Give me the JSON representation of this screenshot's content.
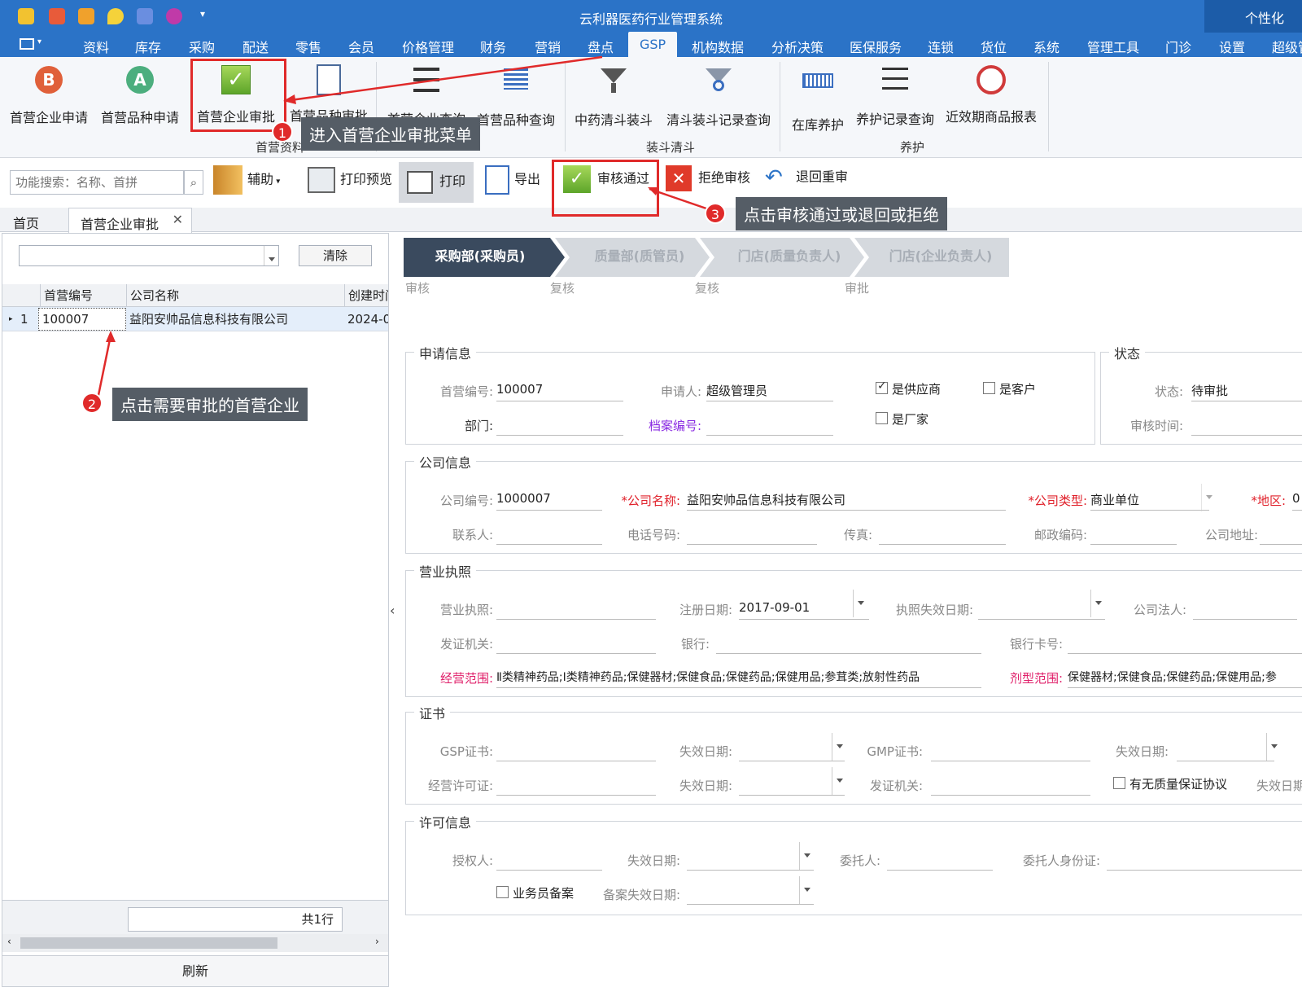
{
  "app": {
    "title": "云利器医药行业管理系统",
    "personal": "个性化"
  },
  "menu": {
    "items": [
      "资料",
      "库存",
      "采购",
      "配送",
      "零售",
      "会员",
      "价格管理",
      "财务",
      "营销",
      "盘点",
      "GSP",
      "机构数据",
      "分析决策",
      "医保服务",
      "连锁",
      "货位",
      "系统",
      "管理工具",
      "门诊",
      "设置",
      "超级管"
    ],
    "active": "GSP"
  },
  "ribbon": {
    "buttons": {
      "first_enterprise_apply": "首营企业申请",
      "first_variety_apply": "首营品种申请",
      "first_enterprise_approve": "首营企业审批",
      "first_variety_approve": "首营品种审批",
      "first_enterprise_query": "首营企业查询",
      "first_variety_query": "首营品种查询",
      "herb_clear_fill": "中药清斗装斗",
      "clear_fill_record_query": "清斗装斗记录查询",
      "in_stock_maintenance": "在库养护",
      "maintenance_record_query": "养护记录查询",
      "near_expiry_report": "近效期商品报表"
    },
    "groups": {
      "first_data": "首营资料",
      "fill_clear": "装斗清斗",
      "maintenance": "养护"
    }
  },
  "toolbar": {
    "search_placeholder": "功能搜索：名称、首拼",
    "assist": "辅助",
    "print_preview": "打印预览",
    "print": "打印",
    "export": "导出",
    "approve": "审核通过",
    "reject": "拒绝审核",
    "return": "退回重审"
  },
  "tabs": {
    "home": "首页",
    "current": "首营企业审批"
  },
  "left": {
    "clear": "清除",
    "columns": [
      "首营编号",
      "公司名称",
      "创建时间"
    ],
    "rows": [
      {
        "idx": "1",
        "code": "100007",
        "company": "益阳安帅品信息科技有限公司",
        "created": "2024-0"
      }
    ],
    "footer": "共1行",
    "refresh": "刷新"
  },
  "workflow": {
    "steps": [
      "采购部(采购员)",
      "质量部(质管员)",
      "门店(质量负责人)",
      "门店(企业负责人)"
    ],
    "subs": [
      "审核",
      "复核",
      "复核",
      "审批"
    ]
  },
  "apply": {
    "legend": "申请信息",
    "code_label": "首营编号:",
    "code": "100007",
    "applicant_label": "申请人:",
    "applicant": "超级管理员",
    "dept_label": "部门:",
    "dept": "",
    "archive_label": "档案编号:",
    "archive": "",
    "is_supplier": "是供应商",
    "is_customer": "是客户",
    "is_manufacturer": "是厂家"
  },
  "status": {
    "legend": "状态",
    "status_label": "状态:",
    "status": "待审批",
    "time_label": "审核时间:",
    "time": ""
  },
  "company": {
    "legend": "公司信息",
    "code_label": "公司编号:",
    "code": "1000007",
    "name_label": "*公司名称:",
    "name": "益阳安帅品信息科技有限公司",
    "type_label": "*公司类型:",
    "type": "商业单位",
    "region_label": "*地区:",
    "region": "0",
    "contact_label": "联系人:",
    "phone_label": "电话号码:",
    "fax_label": "传真:",
    "zip_label": "邮政编码:",
    "address_label": "公司地址:"
  },
  "license": {
    "legend": "营业执照",
    "license_label": "营业执照:",
    "reg_date_label": "注册日期:",
    "reg_date": "2017-09-01",
    "expiry_label": "执照失效日期:",
    "legal_label": "公司法人:",
    "issuer_label": "发证机关:",
    "bank_label": "银行:",
    "card_label": "银行卡号:",
    "scope_label": "经营范围:",
    "scope": "Ⅱ类精神药品;Ⅰ类精神药品;保健器材;保健食品;保健药品;保健用品;参茸类;放射性药品",
    "form_label": "剂型范围:",
    "form": "保健器材;保健食品;保健药品;保健用品;参"
  },
  "cert": {
    "legend": "证书",
    "gsp_label": "GSP证书:",
    "gsp_exp_label": "失效日期:",
    "gmp_label": "GMP证书:",
    "gmp_exp_label": "失效日期:",
    "permit_label": "经营许可证:",
    "permit_exp_label": "失效日期:",
    "permit_issuer_label": "发证机关:",
    "quality_agreement": "有无质量保证协议",
    "qa_exp_label": "失效日期"
  },
  "permit": {
    "legend": "许可信息",
    "auth_label": "授权人:",
    "exp_label": "失效日期:",
    "trustee_label": "委托人:",
    "trustee_id_label": "委托人身份证:",
    "salesman": "业务员备案",
    "record_exp_label": "备案失效日期:"
  },
  "callouts": {
    "c1": "进入首营企业审批菜单",
    "c2": "点击需要审批的首营企业",
    "c3": "点击审核通过或退回或拒绝",
    "b1": "1",
    "b2": "2",
    "b3": "3"
  },
  "colors": {
    "primary": "#2b73c7",
    "step_active": "#3a4a5e",
    "step_inactive": "#d0d4d9",
    "annotation": "#e02a2a"
  }
}
